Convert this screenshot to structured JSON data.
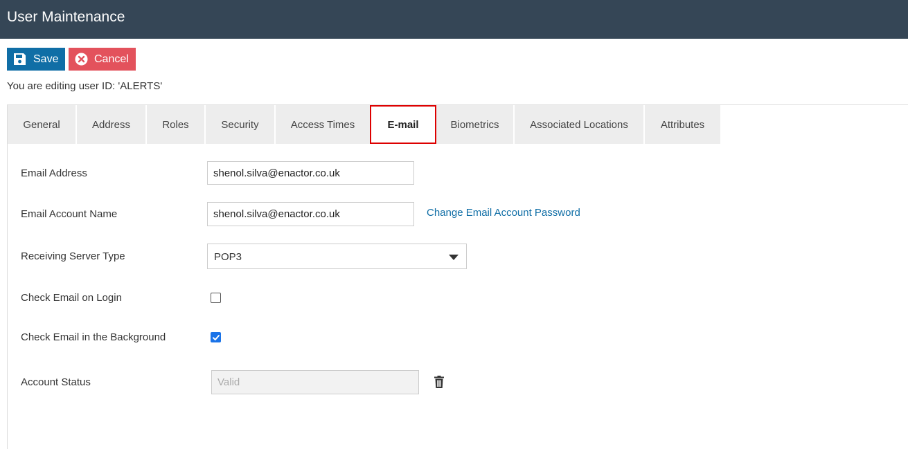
{
  "header": {
    "title": "User Maintenance"
  },
  "toolbar": {
    "save_label": "Save",
    "cancel_label": "Cancel"
  },
  "editing_message": "You are editing user ID: 'ALERTS'",
  "tabs": [
    {
      "label": "General"
    },
    {
      "label": "Address"
    },
    {
      "label": "Roles"
    },
    {
      "label": "Security"
    },
    {
      "label": "Access Times"
    },
    {
      "label": "E-mail",
      "active": true
    },
    {
      "label": "Biometrics"
    },
    {
      "label": "Associated Locations"
    },
    {
      "label": "Attributes"
    }
  ],
  "form": {
    "email_address": {
      "label": "Email Address",
      "value": "shenol.silva@enactor.co.uk"
    },
    "email_account_name": {
      "label": "Email Account Name",
      "value": "shenol.silva@enactor.co.uk"
    },
    "change_password_link": "Change Email Account Password",
    "receiving_server_type": {
      "label": "Receiving Server Type",
      "value": "POP3"
    },
    "check_on_login": {
      "label": "Check Email on Login",
      "checked": false
    },
    "check_in_background": {
      "label": "Check Email in the Background",
      "checked": true
    },
    "account_status": {
      "label": "Account Status",
      "placeholder": "Valid"
    }
  },
  "colors": {
    "header_bg": "#354656",
    "save_bg": "#106ea6",
    "cancel_bg": "#e3525c",
    "active_tab_border": "#dd0000",
    "link": "#106ea6",
    "checkbox_checked": "#1a73e8"
  },
  "icons": {
    "save": "floppy-disk-icon",
    "cancel": "close-circle-icon",
    "dropdown": "caret-down-icon",
    "delete": "trash-icon"
  }
}
